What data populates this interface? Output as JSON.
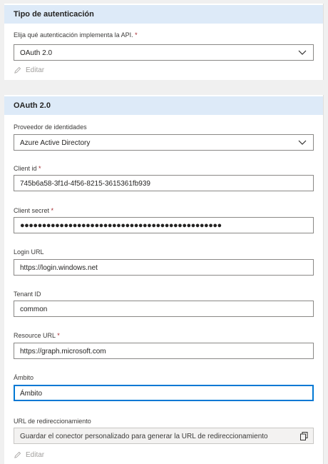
{
  "auth_section": {
    "title": "Tipo de autenticación",
    "api_auth_label": "Elija qué autenticación implementa la API.",
    "api_auth_value": "OAuth 2.0",
    "edit_label": "Editar"
  },
  "oauth_section": {
    "title": "OAuth 2.0",
    "identity_provider": {
      "label": "Proveedor de identidades",
      "value": "Azure Active Directory"
    },
    "client_id": {
      "label": "Client id",
      "value": "745b6a58-3f1d-4f56-8215-3615361fb939"
    },
    "client_secret": {
      "label": "Client secret",
      "value": "●●●●●●●●●●●●●●●●●●●●●●●●●●●●●●●●●●●●●●●●●●●●●●"
    },
    "login_url": {
      "label": "Login URL",
      "value": "https://login.windows.net"
    },
    "tenant_id": {
      "label": "Tenant ID",
      "value": "common"
    },
    "resource_url": {
      "label": "Resource URL",
      "value": "https://graph.microsoft.com"
    },
    "scope": {
      "label": "Ámbito",
      "placeholder": "Ámbito"
    },
    "redirect_url": {
      "label": "URL de redireccionamiento",
      "value": "Guardar el conector personalizado para generar la URL de redireccionamiento"
    },
    "edit_label": "Editar",
    "required_marker": "*"
  },
  "colors": {
    "header_bg": "#ddeaf8",
    "required": "#a4262c",
    "focus": "#0078d4"
  }
}
